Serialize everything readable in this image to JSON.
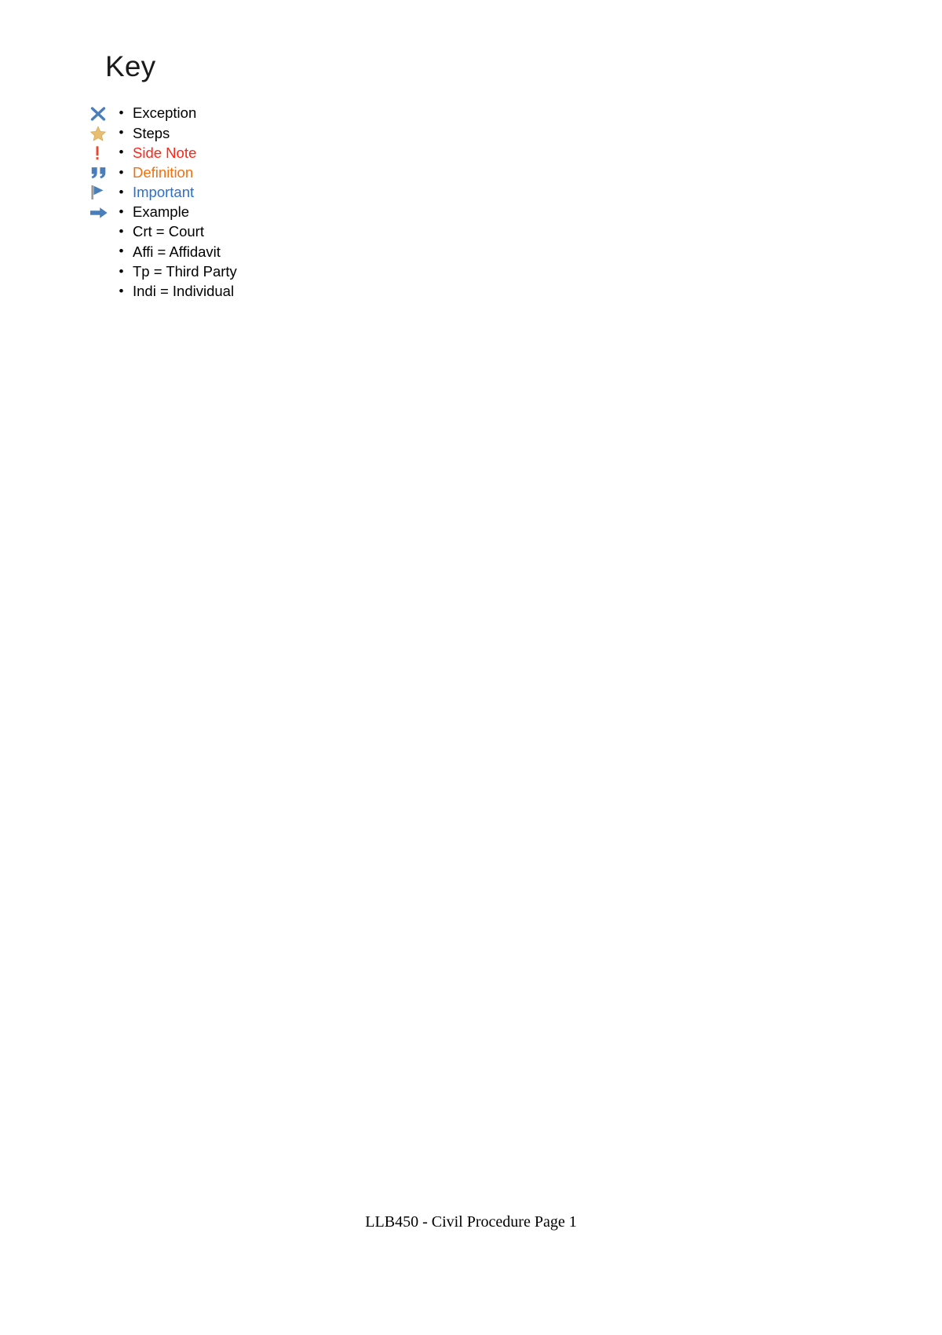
{
  "document": {
    "title": "Key",
    "footer": "LLB450 - Civil Procedure Page 1"
  },
  "key_list": [
    {
      "icon": "cross-x-icon",
      "label": "Exception",
      "color": "#000000"
    },
    {
      "icon": "star-icon",
      "label": "Steps",
      "color": "#000000"
    },
    {
      "icon": "exclamation-mark-icon",
      "label": "Side Note",
      "color": "#FF2416"
    },
    {
      "icon": "quotation-marks-icon",
      "label": "Definition",
      "color": "#F2700F"
    },
    {
      "icon": "flag-icon",
      "label": "Important",
      "color": "#2C6FD1"
    },
    {
      "icon": "arrow-right-icon",
      "label": "Example",
      "color": "#000000"
    },
    {
      "icon": "none",
      "label": "Crt = Court",
      "color": "#000000"
    },
    {
      "icon": "none",
      "label": "Affi = Affidavit",
      "color": "#000000"
    },
    {
      "icon": "none",
      "label": "Tp = Third Party",
      "color": "#000000"
    },
    {
      "icon": "none",
      "label": "Indi = Individual",
      "color": "#000000"
    }
  ],
  "bullet_glyph": "•",
  "colors": {
    "icon_blue": "#4A7EBB",
    "icon_gold": "#E8BE72",
    "icon_red": "#E8492B",
    "flag_pole_gray": "#9B9B9B",
    "text_red": "#FF2416",
    "text_orange": "#F2700F",
    "text_blue": "#2C6FD1"
  }
}
